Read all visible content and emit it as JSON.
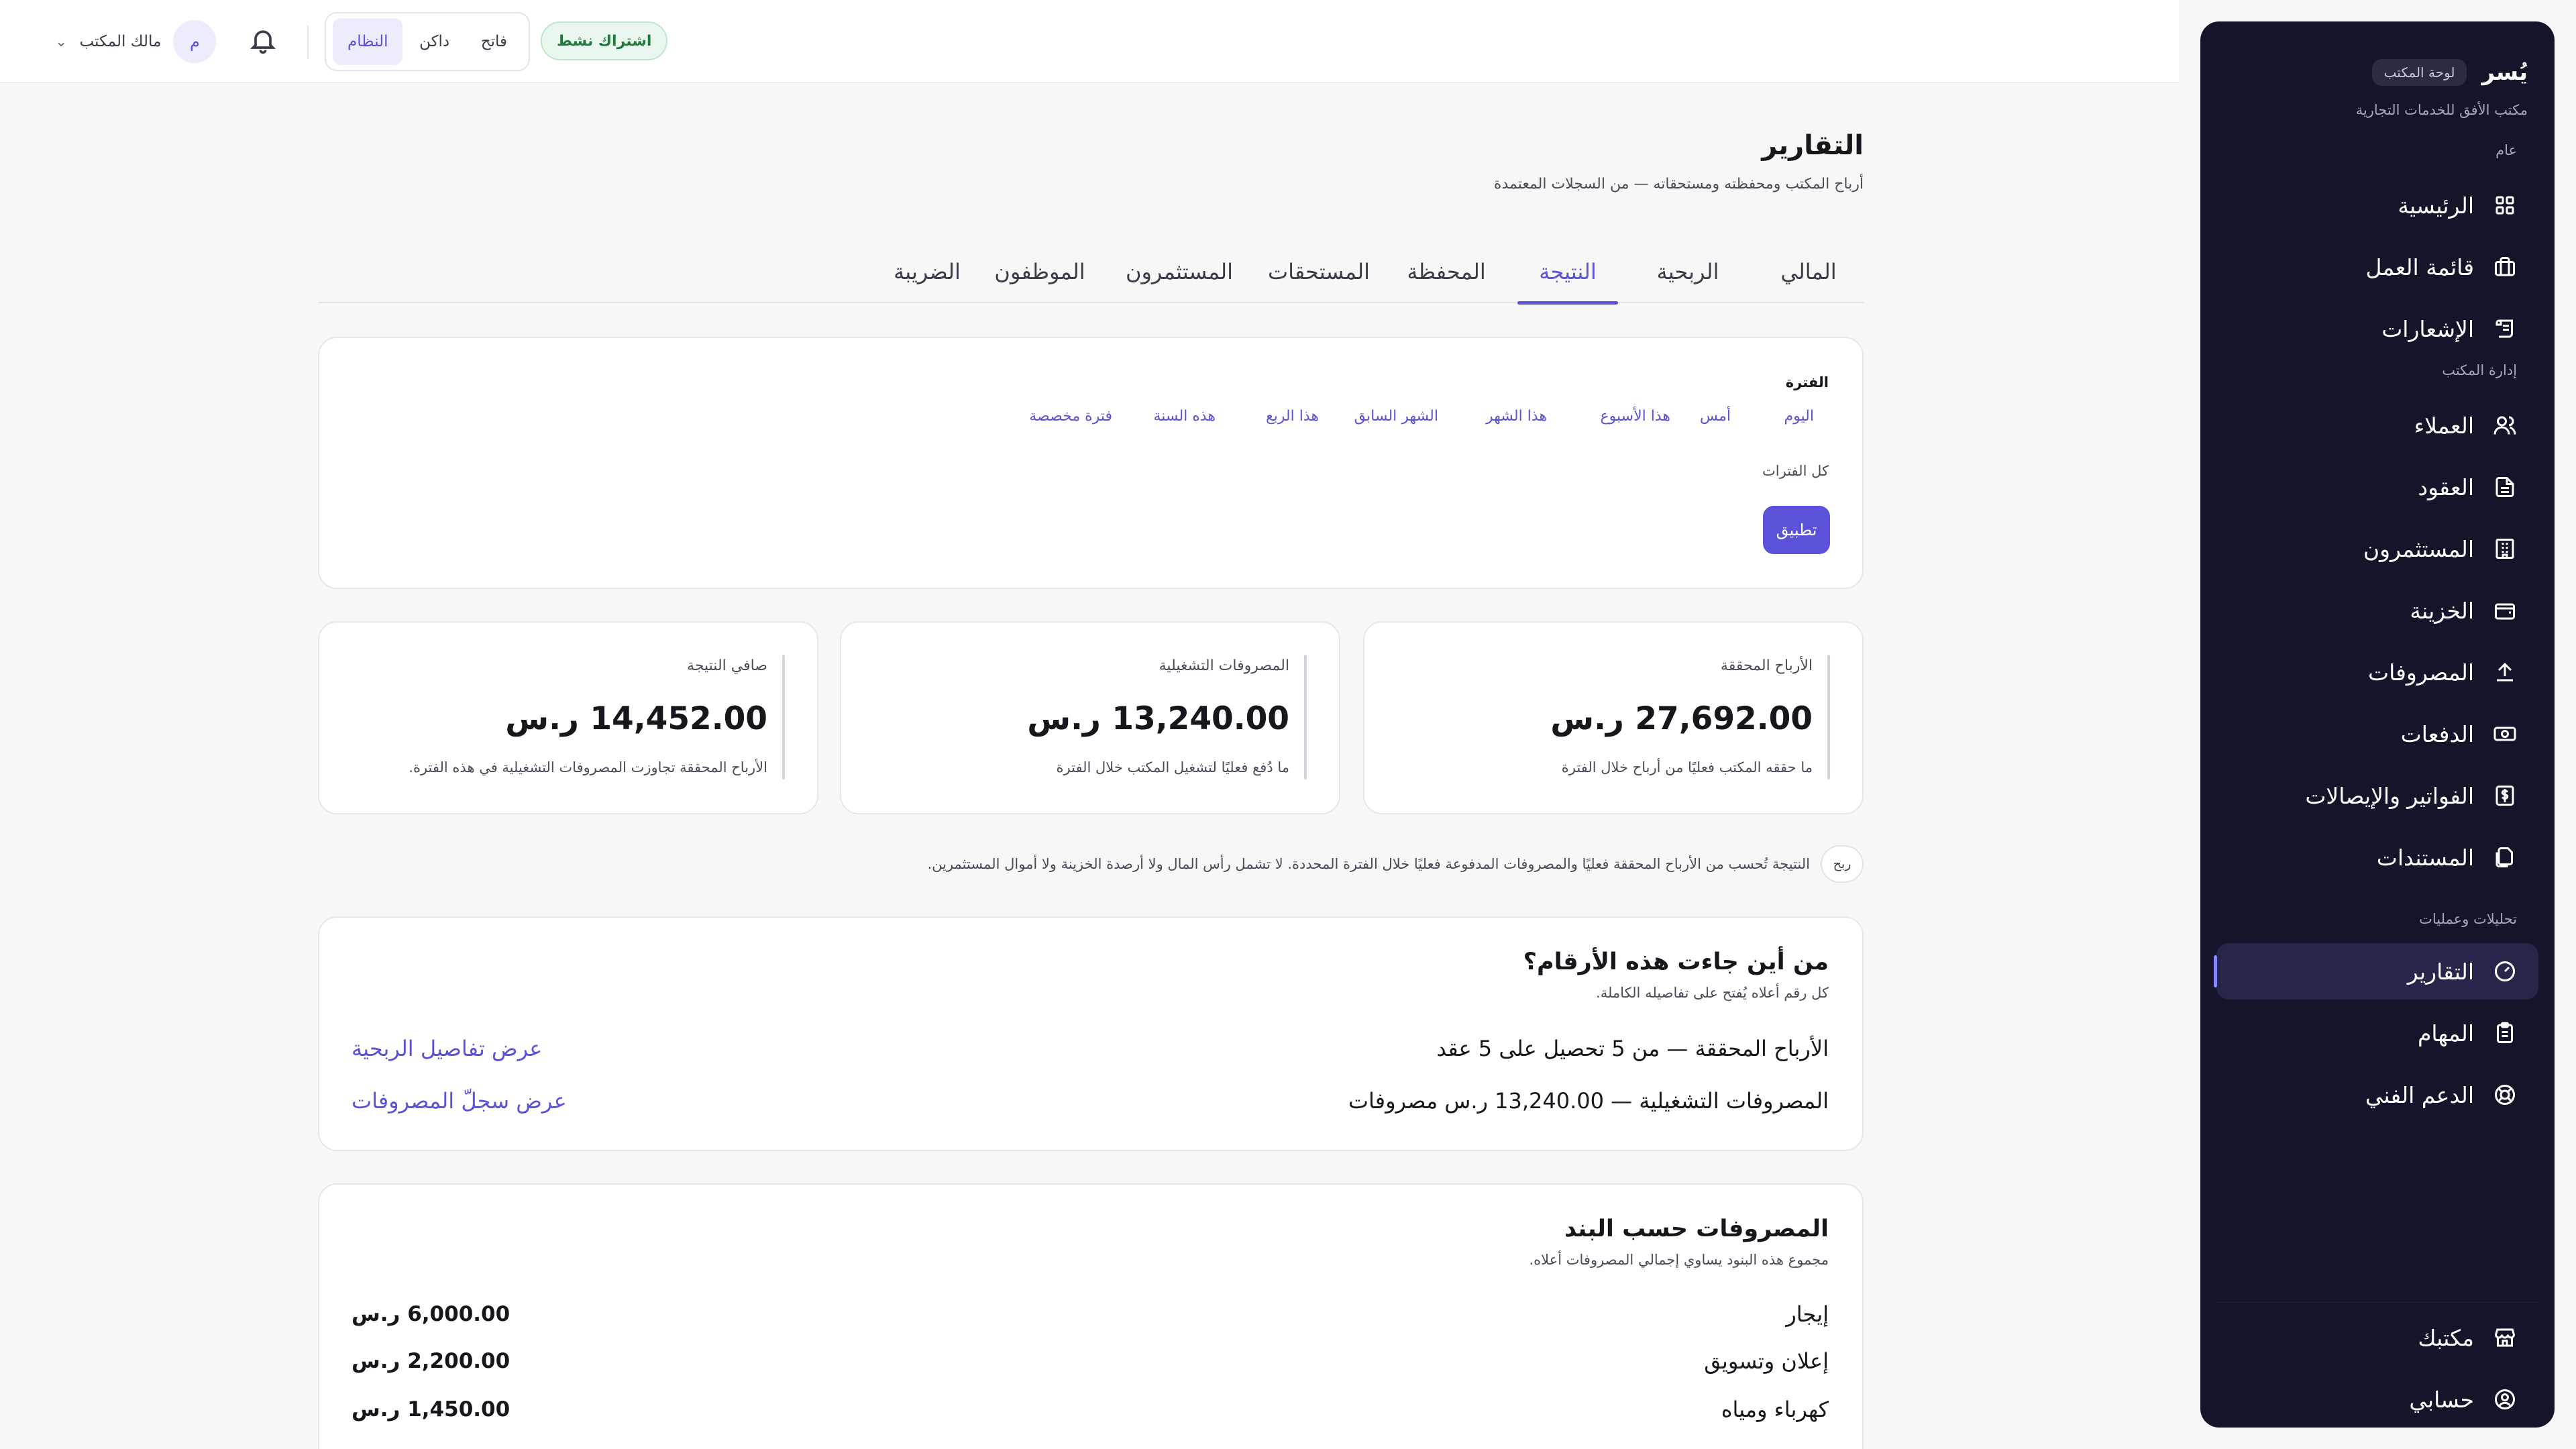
{
  "sidebar": {
    "brand": "يُسر",
    "badge": "لوحة المكتب",
    "office": "مكتب الأفق للخدمات التجارية",
    "sections": {
      "general": "عام",
      "office_mgmt": "إدارة المكتب",
      "analytics": "تحليلات وعمليات"
    },
    "items": [
      {
        "label": "الرئيسية",
        "icon": "grid-icon"
      },
      {
        "label": "قائمة العمل",
        "icon": "briefcase-icon"
      },
      {
        "label": "الإشعارات",
        "icon": "scroll-icon"
      },
      {
        "label": "العملاء",
        "icon": "users-icon"
      },
      {
        "label": "العقود",
        "icon": "document-icon"
      },
      {
        "label": "المستثمرون",
        "icon": "building-icon"
      },
      {
        "label": "الخزينة",
        "icon": "wallet-icon"
      },
      {
        "label": "المصروفات",
        "icon": "upload-icon"
      },
      {
        "label": "الدفعات",
        "icon": "banknote-icon"
      },
      {
        "label": "الفواتير والإيصالات",
        "icon": "receipt-icon"
      },
      {
        "label": "المستندات",
        "icon": "files-icon"
      },
      {
        "label": "التقارير",
        "icon": "gauge-icon"
      },
      {
        "label": "المهام",
        "icon": "clipboard-icon"
      },
      {
        "label": "الدعم الفني",
        "icon": "lifebuoy-icon"
      },
      {
        "label": "مكتبك",
        "icon": "store-icon"
      },
      {
        "label": "حسابي",
        "icon": "user-circle-icon"
      }
    ]
  },
  "topbar": {
    "subscription": "اشتراك نشط",
    "roles": [
      "فاتح",
      "داكن",
      "النظام"
    ],
    "active_role": "النظام",
    "avatar_initial": "م",
    "owner": "مالك المكتب"
  },
  "page": {
    "title": "التقارير",
    "subtitle": "أرباح المكتب ومحفظته ومستحقاته — من السجلات المعتمدة",
    "tabs": [
      "المالي",
      "الربحية",
      "النتيجة",
      "المحفظة",
      "المستحقات",
      "المستثمرون",
      "الموظفون",
      "الضريبة"
    ],
    "active_tab": "النتيجة"
  },
  "period": {
    "title": "الفترة",
    "chips": [
      "اليوم",
      "أمس",
      "هذا الأسبوع",
      "هذا الشهر",
      "الشهر السابق",
      "هذا الربع",
      "هذه السنة",
      "فترة مخصصة"
    ],
    "all": "كل الفترات",
    "apply": "تطبيق"
  },
  "kpis": [
    {
      "label": "الأرباح المحققة",
      "value": "27,692.00 ر.س",
      "desc": "ما حققه المكتب فعليًا من أرباح خلال الفترة"
    },
    {
      "label": "المصروفات التشغيلية",
      "value": "13,240.00 ر.س",
      "desc": "ما دُفع فعليًا لتشغيل المكتب خلال الفترة"
    },
    {
      "label": "صافي النتيجة",
      "value": "14,452.00 ر.س",
      "desc": "الأرباح المحققة تجاوزت المصروفات التشغيلية في هذه الفترة."
    }
  ],
  "note": {
    "tag": "ربح",
    "text": "النتيجة تُحسب من الأرباح المحققة فعليًا والمصروفات المدفوعة فعليًا خلال الفترة المحددة. لا تشمل رأس المال ولا أرصدة الخزينة ولا أموال المستثمرين."
  },
  "sources": {
    "title": "من أين جاءت هذه الأرقام؟",
    "subtitle": "كل رقم أعلاه يُفتح على تفاصيله الكاملة.",
    "rows": [
      {
        "text": "الأرباح المحققة — من 5 تحصيل على 5 عقد",
        "link": "عرض تفاصيل الربحية"
      },
      {
        "text": "المصروفات التشغيلية — 13,240.00 ر.س مصروفات",
        "link": "عرض سجلّ المصروفات"
      }
    ]
  },
  "expenses": {
    "title": "المصروفات حسب البند",
    "subtitle": "مجموع هذه البنود يساوي إجمالي المصروفات أعلاه.",
    "rows": [
      {
        "name": "إيجار",
        "amount": "6,000.00 ر.س"
      },
      {
        "name": "إعلان وتسويق",
        "amount": "2,200.00 ر.س"
      },
      {
        "name": "كهرباء ومياه",
        "amount": "1,450.00 ر.س"
      }
    ]
  },
  "colors": {
    "accent": "#5b52d9",
    "sidebar_bg": "#14142a",
    "success": "#207a3c"
  }
}
